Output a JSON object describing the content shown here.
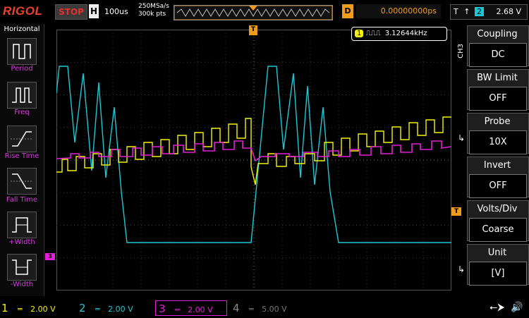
{
  "topbar": {
    "brand": "RIGOL",
    "run_state": "STOP",
    "horizontal_tag": "H",
    "timebase": "100us",
    "sample_rate": "250MSa/s",
    "memory_depth": "300k pts",
    "delay_tag": "D",
    "delay_value": "0.00000000ps",
    "trigger_tag": "T",
    "trigger_source": "2",
    "trigger_level": "2.68 V"
  },
  "left_panel": {
    "title": "Horizontal",
    "items": [
      {
        "label": "Period"
      },
      {
        "label": "Freq"
      },
      {
        "label": "Rise Time"
      },
      {
        "label": "Fall Time"
      },
      {
        "label": "+Width"
      },
      {
        "label": "-Width"
      }
    ]
  },
  "measurement": {
    "channel": "1",
    "value": "3.12644kHz"
  },
  "right_panel": {
    "channel_tag": "CH3",
    "items": [
      {
        "title": "Coupling",
        "value": "DC"
      },
      {
        "title": "BW Limit",
        "value": "OFF"
      },
      {
        "title": "Probe",
        "value": "10X"
      },
      {
        "title": "Invert",
        "value": "OFF"
      },
      {
        "title": "Volts/Div",
        "value": "Coarse"
      },
      {
        "title": "Unit",
        "value": "[V]"
      }
    ]
  },
  "channels": [
    {
      "num": "1",
      "scale": "2.00 V",
      "color": "#f5f10e"
    },
    {
      "num": "2",
      "scale": "2.00 V",
      "color": "#1ec7d4"
    },
    {
      "num": "3",
      "scale": "2.00 V",
      "color": "#e320d8"
    },
    {
      "num": "4",
      "scale": "5.00 V",
      "color": "#3a5cd8"
    }
  ],
  "markers": {
    "trigger_marker": "T",
    "ch3_marker": "3"
  },
  "colors": {
    "brand": "#e8412f",
    "accent": "#ef9c1d",
    "ch1": "#f5f10e",
    "ch2": "#1ec7d4",
    "ch3": "#e320d8"
  }
}
